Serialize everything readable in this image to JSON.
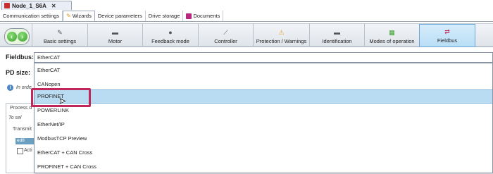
{
  "window": {
    "node_tab_title": "Node_1_S6A"
  },
  "top_tabs": [
    {
      "label": "Communication settings"
    },
    {
      "label": "Wizards"
    },
    {
      "label": "Device parameters"
    },
    {
      "label": "Drive storage"
    },
    {
      "label": "Documents"
    }
  ],
  "wizard_steps": [
    {
      "label": "Basic settings",
      "icon": "wrench-icon"
    },
    {
      "label": "Motor",
      "icon": "motor-icon"
    },
    {
      "label": "Feedback mode",
      "icon": "feedback-icon"
    },
    {
      "label": "Controller",
      "icon": "controller-icon"
    },
    {
      "label": "Protection / Warnings",
      "icon": "warning-icon"
    },
    {
      "label": "Identification",
      "icon": "identification-icon"
    },
    {
      "label": "Modes of operation",
      "icon": "modes-icon"
    },
    {
      "label": "Fieldbus",
      "icon": "fieldbus-icon",
      "active": true
    }
  ],
  "fieldbus": {
    "label": "Fieldbus:",
    "current_value": "EtherCAT",
    "options": [
      "EtherCAT",
      "CANopen",
      "PROFINET",
      "POWERLINK",
      "EtherNet/IP",
      "ModbusTCP Preview",
      "EtherCAT + CAN Cross",
      "PROFINET + CAN Cross"
    ],
    "hovered_option": "PROFINET"
  },
  "background": {
    "pd_size_label": "PD size:",
    "info_text_fragment": "In orde",
    "process_group_fragment": "Process d",
    "to_select_fragment": "To sel",
    "transmit_fragment": "Transmit",
    "table_cell_fragment": "ed8",
    "checkbox_fragment": "Acti"
  },
  "colors": {
    "selection": "#b9dcf3",
    "highlight_border": "#c0285a",
    "active_step": "#b9def6"
  }
}
